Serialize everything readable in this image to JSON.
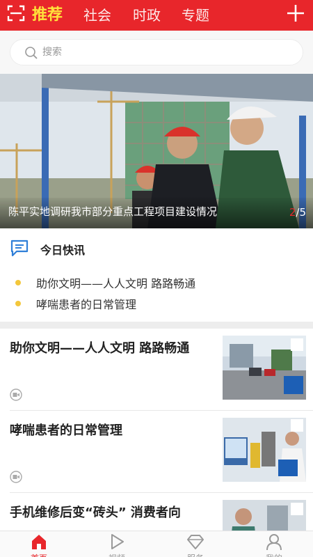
{
  "header": {
    "tabs": [
      {
        "label": "推荐",
        "active": true
      },
      {
        "label": "社会",
        "active": false
      },
      {
        "label": "时政",
        "active": false
      },
      {
        "label": "专题",
        "active": false
      }
    ],
    "icons": {
      "left": "scan-icon",
      "right": "plus-icon"
    }
  },
  "search": {
    "placeholder": "搜索"
  },
  "banner": {
    "title": "陈平实地调研我市部分重点工程项目建设情况",
    "current": "2",
    "total": "/5"
  },
  "flash": {
    "title": "今日快讯",
    "items": [
      "助你文明——人人文明 路路畅通",
      "哮喘患者的日常管理"
    ]
  },
  "news": [
    {
      "title": "助你文明——人人文明 路路畅通",
      "icon": "video-icon"
    },
    {
      "title": "哮喘患者的日常管理",
      "icon": "video-icon"
    },
    {
      "title": "手机维修后变“砖头” 消费者向",
      "icon": "video-icon"
    }
  ],
  "tabbar": [
    {
      "label": "首页",
      "icon": "home-icon",
      "active": true
    },
    {
      "label": "视频",
      "icon": "play-icon",
      "active": false
    },
    {
      "label": "服务",
      "icon": "diamond-icon",
      "active": false
    },
    {
      "label": "我的",
      "icon": "user-icon",
      "active": false
    }
  ],
  "colors": {
    "brand": "#e8262b",
    "active_tab": "#ffe33b",
    "dot": "#f3c73c"
  }
}
